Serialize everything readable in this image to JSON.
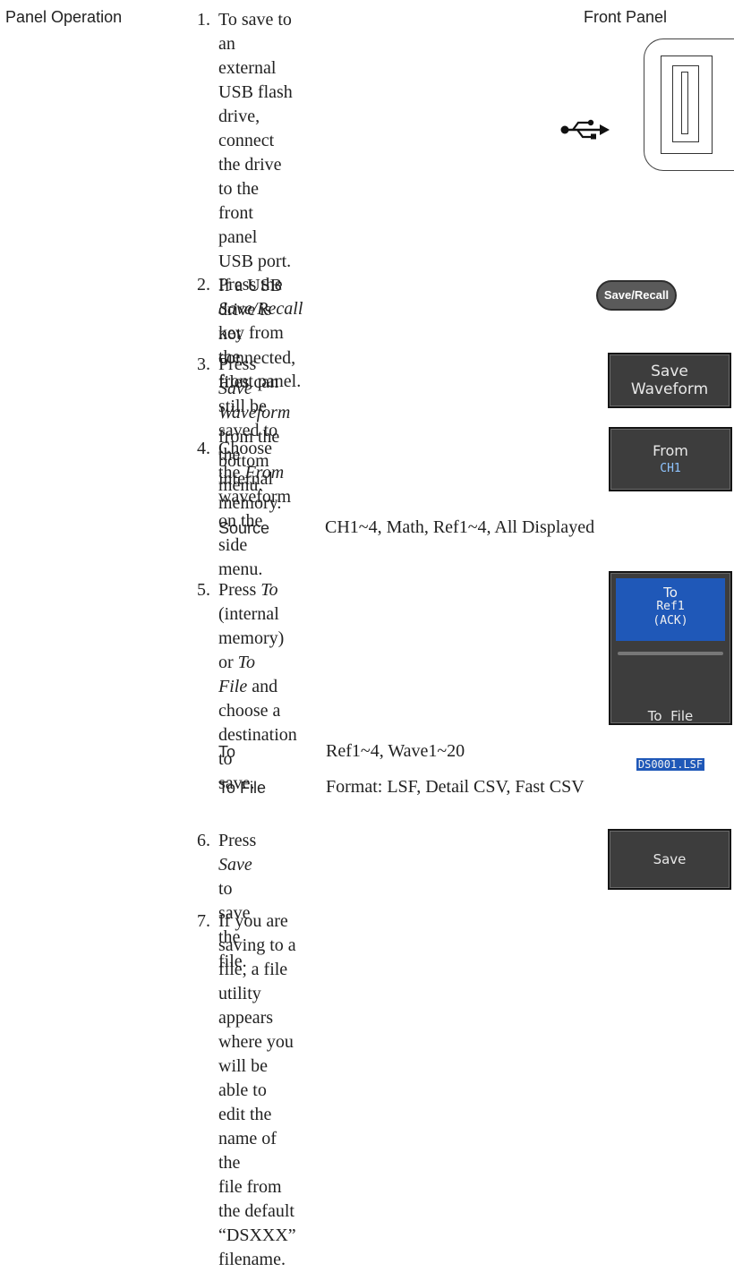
{
  "section_label": "Panel Operation",
  "front_panel_label": "Front Panel",
  "icons": {
    "usb": "usb-icon",
    "port": "usb-port-icon"
  },
  "steps": [
    {
      "num": "1.",
      "lines": [
        "To save to an external USB flash",
        "drive, connect the drive to the",
        "front panel USB port. If a USB",
        "drive is not connected, files can",
        "still be saved to the internal",
        "memory."
      ]
    },
    {
      "num": "2.",
      "pre": "Press the ",
      "em": "Save/Recall",
      "post": " key from the",
      "line2": "front panel."
    },
    {
      "num": "3.",
      "pre": "Press ",
      "em": "Save Waveform",
      "post": " from the",
      "line2": "bottom menu."
    },
    {
      "num": "4.",
      "pre": "Choose the ",
      "em": "From",
      "post": " waveform on the",
      "line2": "side menu."
    },
    {
      "num": "5.",
      "pre": "Press ",
      "em": "To",
      "post": " (internal memory) or ",
      "em2": "To",
      "line2_em": "File",
      "line2_post": " and choose a destination to",
      "line3": "save."
    },
    {
      "num": "6.",
      "pre": "Press ",
      "em": "Save",
      "post": " to save the file."
    },
    {
      "num": "7.",
      "lines": [
        "If you are saving to a file, a file utility appears",
        "where you will be able to edit the name of the",
        "file from the default “DSXXX” filename."
      ]
    }
  ],
  "source_row": {
    "key": "Source",
    "value": "CH1~4, Math, Ref1~4, All Displayed"
  },
  "to_rows": [
    {
      "key": "To",
      "value": "Ref1~4, Wave1~20"
    },
    {
      "key": "To File",
      "value": "Format: LSF, Detail CSV, Fast CSV"
    }
  ],
  "buttons": {
    "save_recall": "Save/Recall",
    "save_waveform": {
      "line1": "Save",
      "line2": "Waveform"
    },
    "from": {
      "label": "From",
      "value": "CH1"
    },
    "to": {
      "label": "To",
      "line1": "Ref1",
      "line2": "(ACK)"
    },
    "to_file": {
      "label": "To  File",
      "value": "DS0001.LSF"
    },
    "save": "Save"
  },
  "colors": {
    "button_bg": "#3d3d3d",
    "highlight": "#1f58b8",
    "value_text": "#8fc4ff"
  }
}
